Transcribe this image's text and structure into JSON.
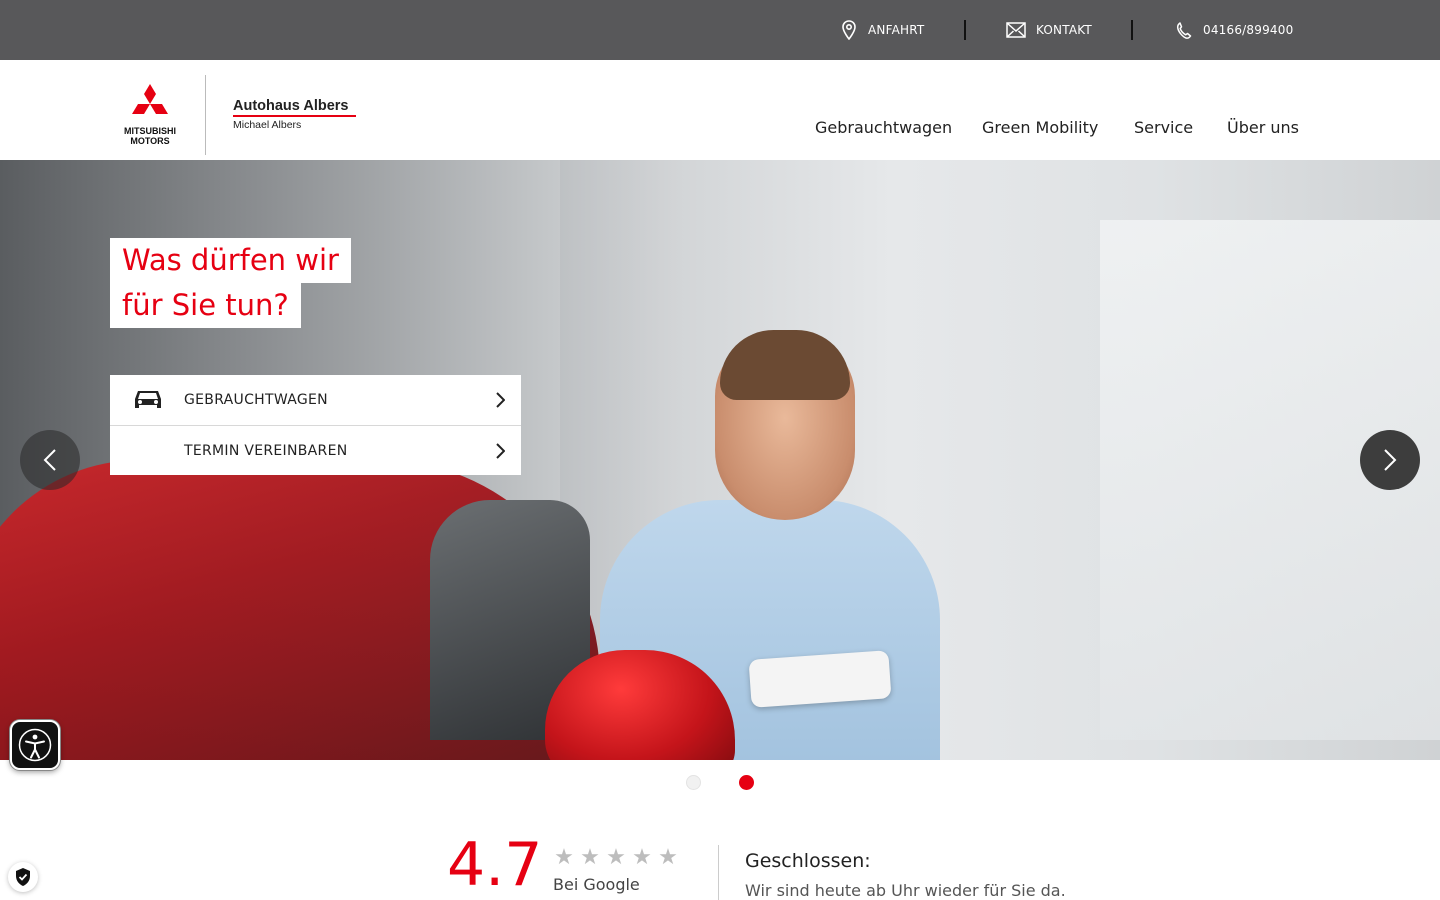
{
  "topbar": {
    "items": [
      {
        "label": "ANFAHRT",
        "icon": "map-pin-icon"
      },
      {
        "label": "KONTAKT",
        "icon": "mail-icon"
      },
      {
        "label": "04166/899400",
        "icon": "phone-icon"
      }
    ]
  },
  "header": {
    "brand": {
      "line1": "MITSUBISHI",
      "line2": "MOTORS"
    },
    "dealer": {
      "name": "Autohaus Albers",
      "owner": "Michael Albers"
    },
    "nav": [
      "Gebrauchtwagen",
      "Green Mobility",
      "Service",
      "Über uns"
    ]
  },
  "hero": {
    "title_line1": "Was dürfen wir",
    "title_line2": "für Sie tun?",
    "actions": [
      {
        "label": "GEBRAUCHTWAGEN",
        "icon": "car-icon"
      },
      {
        "label": "TERMIN VEREINBAREN",
        "icon": ""
      }
    ],
    "slides_count": 2,
    "active_slide": 2
  },
  "rating": {
    "value": "4.7",
    "stars": [
      "★",
      "★",
      "★",
      "★",
      "★"
    ],
    "source": "Bei Google"
  },
  "hours": {
    "status": "Geschlossen:",
    "text": "Wir sind heute ab Uhr wieder für Sie da."
  },
  "colors": {
    "accent": "#e60012",
    "topbar": "#58585a"
  }
}
